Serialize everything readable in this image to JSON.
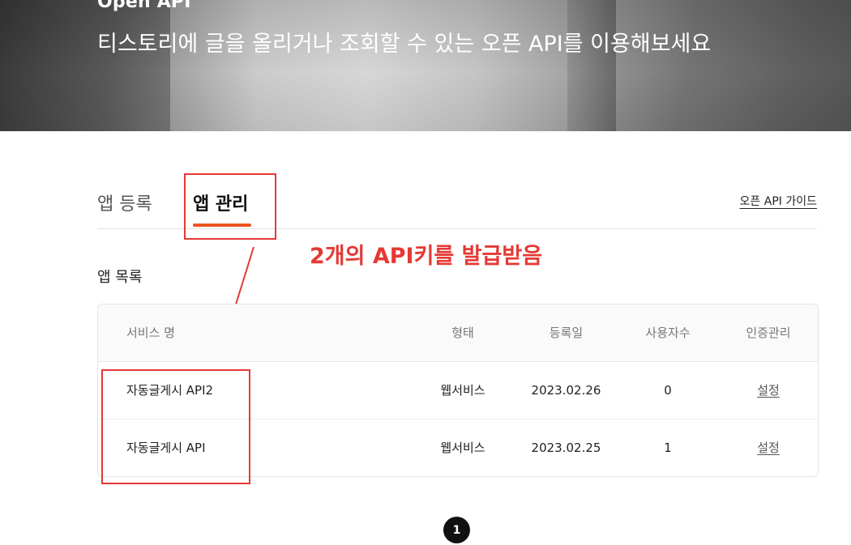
{
  "hero": {
    "title": "Open API",
    "subtitle": "티스토리에 글을 올리거나 조회할 수 있는 오픈 API를 이용해보세요"
  },
  "tabs": {
    "register_label": "앱 등록",
    "manage_label": "앱 관리",
    "guide_link": "오픈 API 가이드"
  },
  "annotation": {
    "text": "2개의 API키를 발급받음",
    "color": "#e53935"
  },
  "app_list": {
    "title": "앱 목록",
    "headers": [
      "서비스 명",
      "형태",
      "등록일",
      "사용자수",
      "인증관리"
    ],
    "rows": [
      {
        "name": "자동글게시 API2",
        "type": "웹서비스",
        "date": "2023.02.26",
        "users": "0",
        "auth": "설정"
      },
      {
        "name": "자동글게시 API",
        "type": "웹서비스",
        "date": "2023.02.25",
        "users": "1",
        "auth": "설정"
      }
    ]
  },
  "pagination": {
    "current_page": "1"
  },
  "colors": {
    "accent": "#eb531f",
    "annotation": "#e53935",
    "pagination_active": "#111111"
  }
}
